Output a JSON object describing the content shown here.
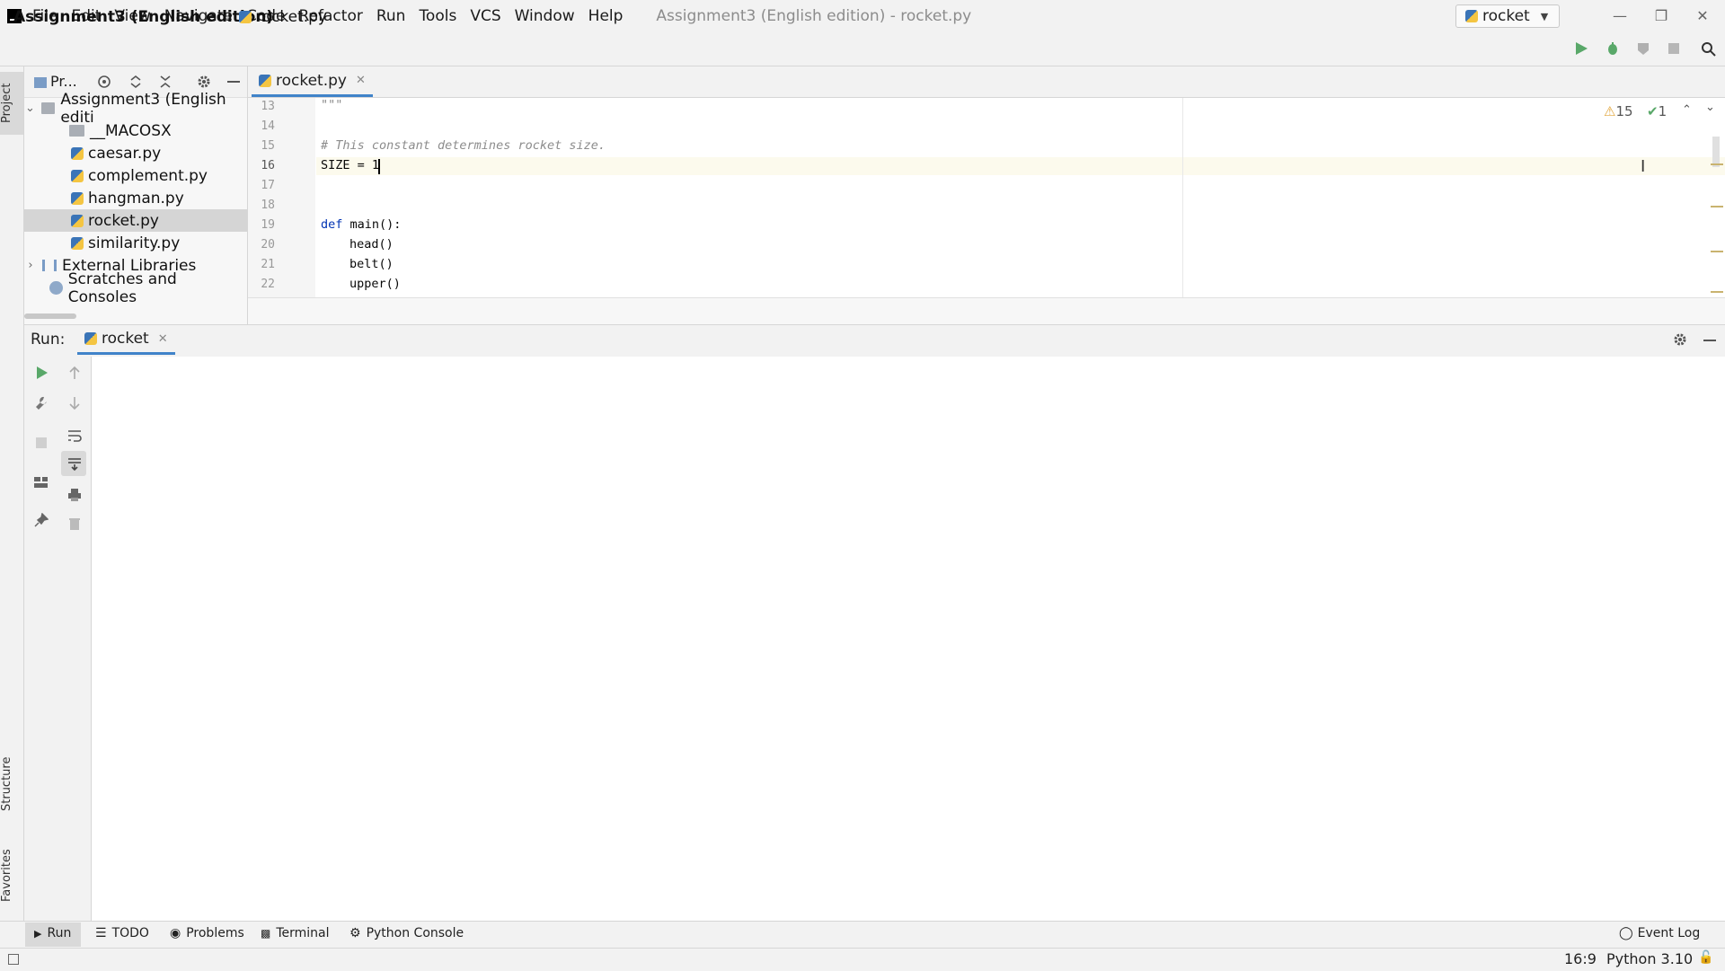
{
  "menu": {
    "items": [
      "File",
      "Edit",
      "View",
      "Navigate",
      "Code",
      "Refactor",
      "Run",
      "Tools",
      "VCS",
      "Window",
      "Help"
    ],
    "window_title": "Assignment3 (English edition) - rocket.py"
  },
  "navbar": {
    "project": "Assignment3 (English edition)",
    "file": "rocket.py",
    "run_config": "rocket"
  },
  "sidebar": {
    "project_tab": "Project",
    "structure_tab": "Structure",
    "favorites_tab": "Favorites",
    "toolbar_label": "Pr..."
  },
  "tree": {
    "root": "Assignment3 (English editi",
    "items": [
      "__MACOSX",
      "caesar.py",
      "complement.py",
      "hangman.py",
      "rocket.py",
      "similarity.py"
    ],
    "external": "External Libraries",
    "scratches": "Scratches and Consoles"
  },
  "editor": {
    "tab": "rocket.py",
    "line_numbers": [
      "13",
      "14",
      "15",
      "16",
      "17",
      "18",
      "19",
      "20",
      "21",
      "22"
    ],
    "comment": "# This constant determines rocket size.",
    "size_line": "SIZE = 1",
    "def_kw": "def",
    "def_rest": " main():",
    "calls": [
      "head()",
      "belt()",
      "upper()"
    ],
    "docstring_end": "\"\"\"",
    "warnings": "15",
    "checks": "1"
  },
  "run": {
    "label": "Run:",
    "tab": "rocket"
  },
  "bottom_tabs": [
    "Run",
    "TODO",
    "Problems",
    "Terminal",
    "Python Console"
  ],
  "event_log": "Event Log",
  "status": {
    "position": "16:9",
    "interpreter": "Python 3.10"
  },
  "colors": {
    "accent": "#4083c9",
    "run_green": "#59a869",
    "warning": "#e2a53a"
  }
}
